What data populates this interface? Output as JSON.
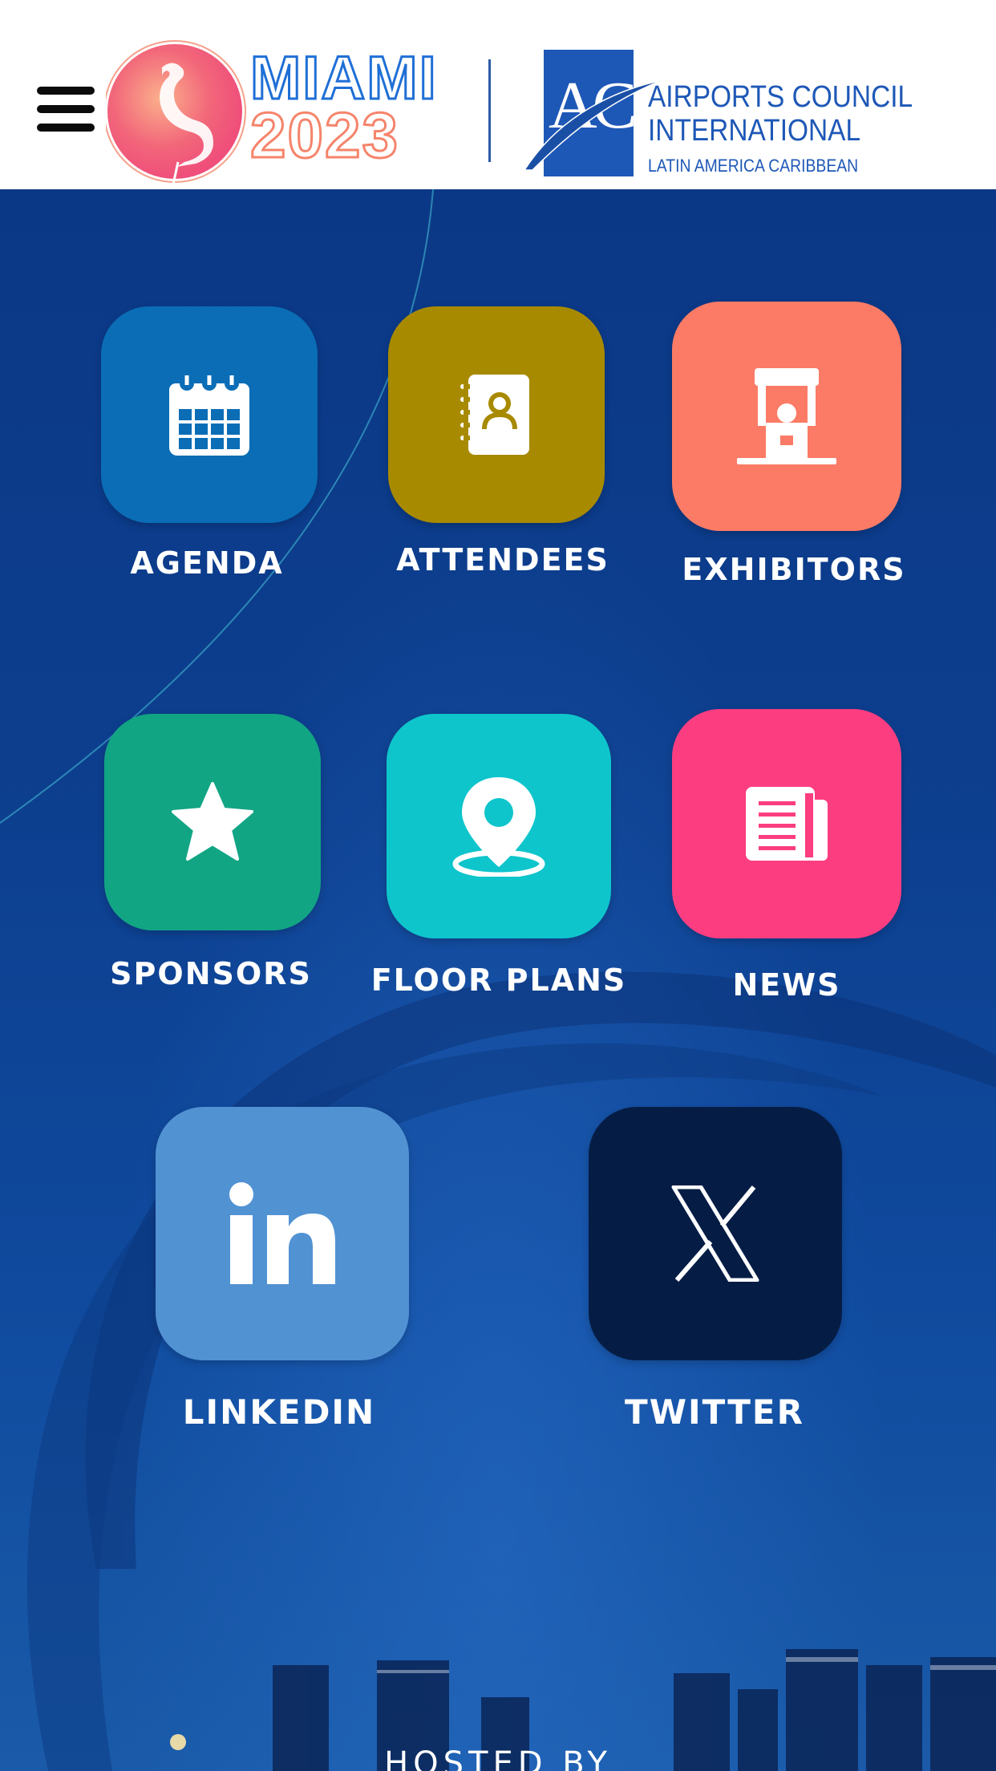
{
  "header": {
    "menu_icon": "hamburger-menu-icon",
    "event_logo": {
      "word": "MIAMI",
      "year": "2023",
      "colors": {
        "word": "#1f6fd6",
        "year": "#f5846b",
        "flamingo_circle": "#f26b7e"
      }
    },
    "org_logo": {
      "letters": "ACI",
      "name_line1": "AIRPORTS COUNCIL",
      "name_line2": "INTERNATIONAL",
      "region": "LATIN AMERICA CARIBBEAN",
      "color": "#1e58b7"
    }
  },
  "tiles": [
    {
      "label": "AGENDA",
      "icon": "calendar-icon",
      "color": "#0a6db6"
    },
    {
      "label": "ATTENDEES",
      "icon": "address-book-icon",
      "color": "#a88a00"
    },
    {
      "label": "EXHIBITORS",
      "icon": "exhibitor-booth-icon",
      "color": "#fb7b66"
    },
    {
      "label": "SPONSORS",
      "icon": "star-icon",
      "color": "#12a584"
    },
    {
      "label": "FLOOR PLANS",
      "icon": "map-pin-icon",
      "color": "#0ec5cc"
    },
    {
      "label": "NEWS",
      "icon": "newspaper-icon",
      "color": "#fc3d80"
    },
    {
      "label": "LINKEDIN",
      "icon": "linkedin-icon",
      "color": "#5192d3"
    },
    {
      "label": "TWITTER",
      "icon": "x-logo-icon",
      "color": "#051d45"
    }
  ],
  "footer": {
    "hosted_by": "HOSTED BY"
  }
}
